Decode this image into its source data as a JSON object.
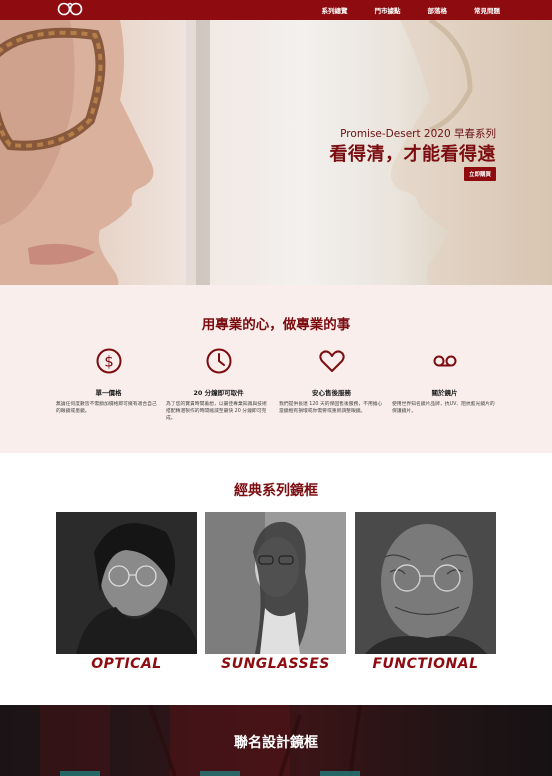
{
  "nav": {
    "links": [
      "系列總覽",
      "門市據點",
      "部落格",
      "常見問題"
    ],
    "logo_icon": "glasses-logo-icon",
    "bg_color": "#8e0c10"
  },
  "hero": {
    "subtitle": "Promise-Desert 2020 早春系列",
    "title": "看得清，才能看得遠",
    "cta": "立即購買"
  },
  "features": {
    "title": "用專業的心，做專業的事",
    "items": [
      {
        "icon": "dollar-icon",
        "title": "單一價格",
        "desc": "無論任何度數皆不需額加價格即可擁有適合自己的眼鏡或墨鏡。"
      },
      {
        "icon": "clock-icon",
        "title": "20 分鐘即可取件",
        "desc": "為了您的寶貴時間着想，以最佳專業知識與技術搭配精湛製作的時間縮減至最快 20 分鐘即可完成。"
      },
      {
        "icon": "heart-icon",
        "title": "安心售後服務",
        "desc": "我們提供長達 120 天的保固售後服務，不用擔心當鏡框有損壞或你需要或重新調整眼鏡。"
      },
      {
        "icon": "cassette-icon",
        "title": "關於鏡片",
        "desc": "使用世界知名鏡片品牌，抗UV、阻抗藍光鏡片的保護鏡片。"
      }
    ]
  },
  "collection": {
    "title": "經典系列鏡框",
    "cards": [
      "OPTICAL",
      "SUNGLASSES",
      "FUNCTIONAL"
    ]
  },
  "band": {
    "title": "聯名設計鏡框"
  }
}
